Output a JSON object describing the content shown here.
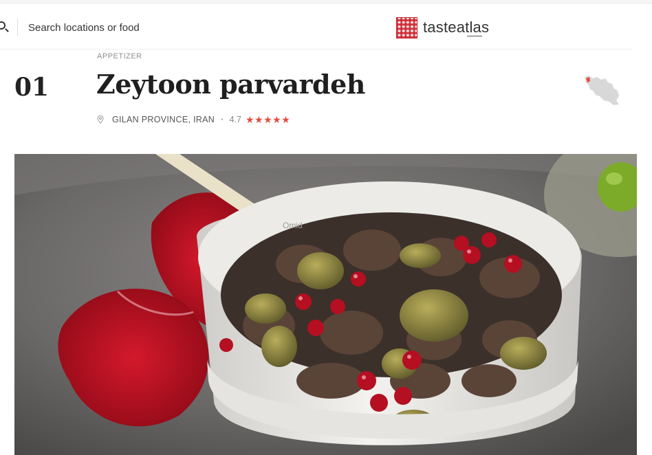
{
  "header": {
    "search_placeholder": "Search locations or food",
    "logo_text": "tasteatlas"
  },
  "dish": {
    "category": "APPETIZER",
    "rank": "01",
    "title": "Zeytoon parvardeh",
    "location": "GILAN PROVINCE, IRAN",
    "rating": "4.7",
    "stars": "★★★★★",
    "star_count": 5
  },
  "photo": {
    "watermark": "Omid"
  },
  "colors": {
    "accent": "#e44b3d",
    "logo_red": "#c8232d"
  },
  "icons": [
    "search-icon",
    "tasteatlas-logo-icon",
    "location-pin-icon",
    "star-icon",
    "iran-map-icon"
  ]
}
